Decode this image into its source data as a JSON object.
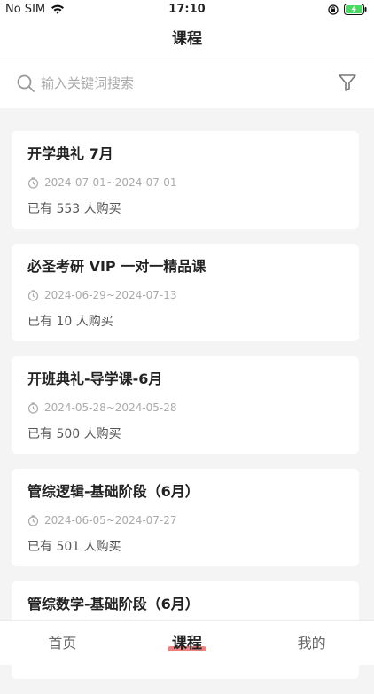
{
  "status": {
    "carrier": "No SIM",
    "time": "17:10"
  },
  "nav": {
    "title": "课程"
  },
  "search": {
    "placeholder": "输入关键词搜索"
  },
  "courses": [
    {
      "title": "开学典礼 7月",
      "date": "2024-07-01~2024-07-01",
      "buyers": "已有 553 人购买"
    },
    {
      "title": "必圣考研 VIP 一对一精品课",
      "date": "2024-06-29~2024-07-13",
      "buyers": "已有 10 人购买"
    },
    {
      "title": "开班典礼-导学课-6月",
      "date": "2024-05-28~2024-05-28",
      "buyers": "已有 500 人购买"
    },
    {
      "title": "管综逻辑-基础阶段（6月）",
      "date": "2024-06-05~2024-07-27",
      "buyers": "已有 501 人购买"
    },
    {
      "title": "管综数学-基础阶段（6月）",
      "date": "",
      "buyers": ""
    }
  ],
  "tabs": [
    {
      "label": "首页"
    },
    {
      "label": "课程"
    },
    {
      "label": "我的"
    }
  ],
  "colors": {
    "accent": "#e86b6b",
    "battery": "#4cd964"
  }
}
